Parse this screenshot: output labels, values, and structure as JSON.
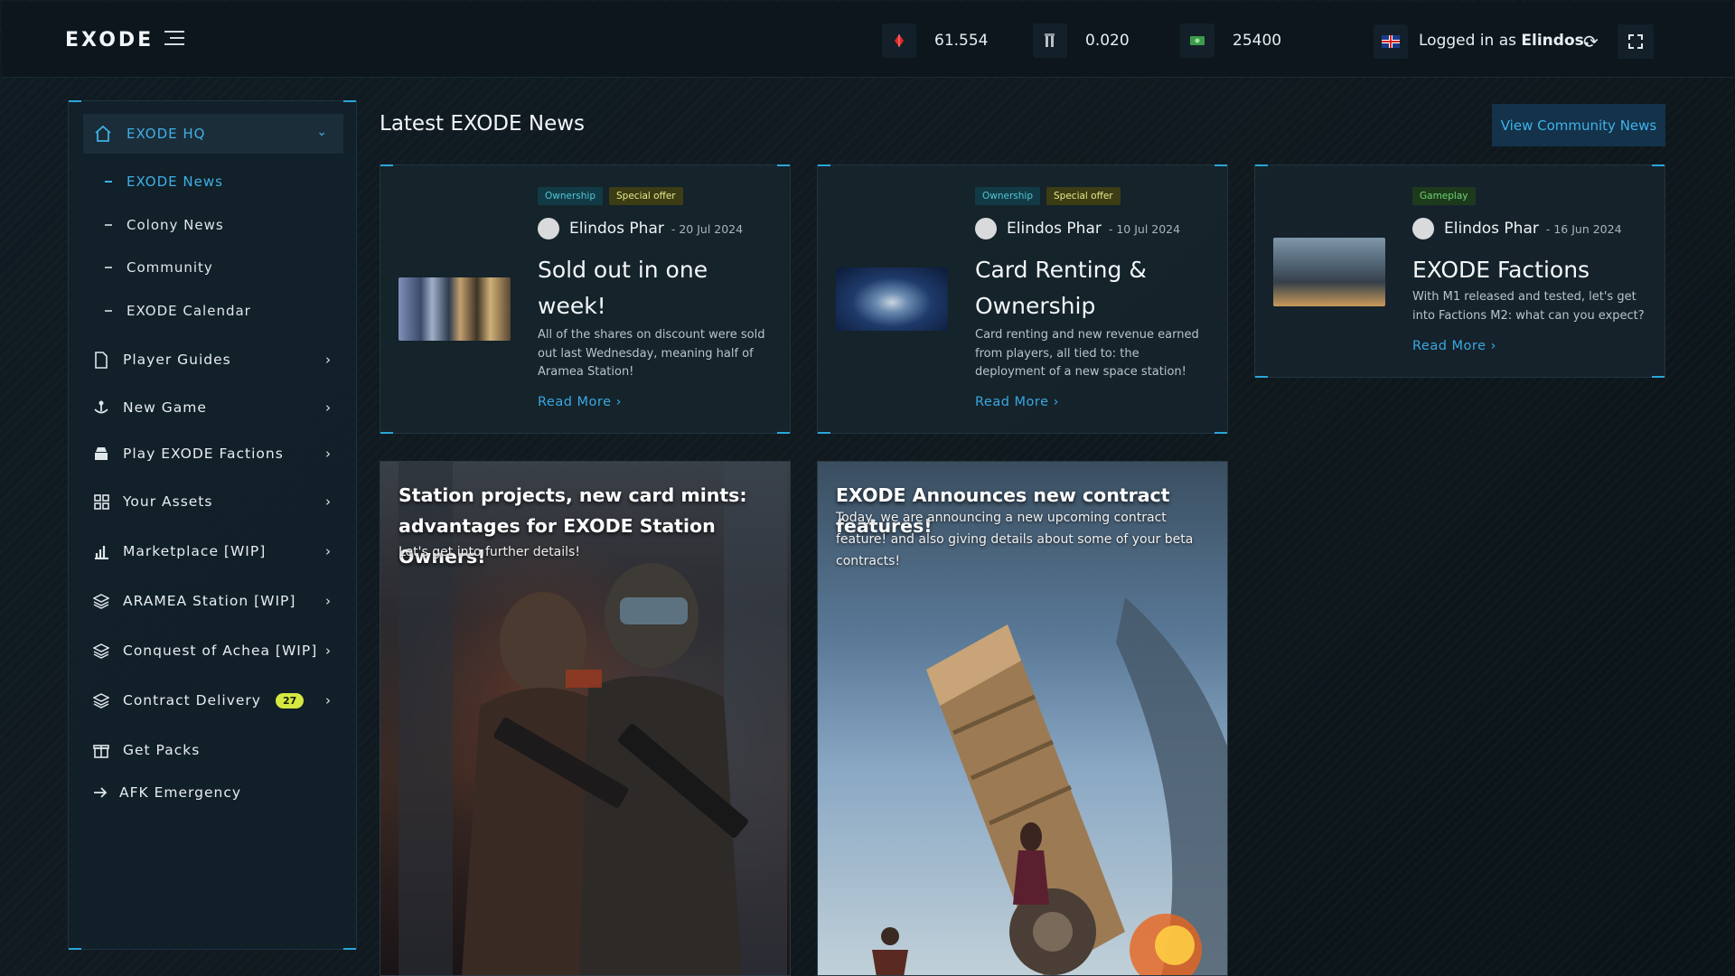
{
  "header": {
    "logo": "EXODE",
    "resources": [
      {
        "icon": "red-crystal-icon",
        "value": "61.554"
      },
      {
        "icon": "tower-token-icon",
        "value": "0.020"
      },
      {
        "icon": "cash-icon",
        "value": "25400"
      }
    ],
    "logged_prefix": "Logged in as",
    "username": "Elindos."
  },
  "sidebar": {
    "active_section": "EXODE HQ",
    "sub_items": [
      "EXODE News",
      "Colony News",
      "Community",
      "EXODE Calendar"
    ],
    "items": [
      {
        "label": "Player Guides",
        "icon": "document-icon"
      },
      {
        "label": "New Game",
        "icon": "anchor-icon"
      },
      {
        "label": "Play EXODE Factions",
        "icon": "factions-icon"
      },
      {
        "label": "Your Assets",
        "icon": "grid-icon"
      },
      {
        "label": "Marketplace [WIP]",
        "icon": "bar-chart-icon"
      },
      {
        "label": "ARAMEA Station [WIP]",
        "icon": "layers-icon"
      },
      {
        "label": "Conquest of Achea [WIP]",
        "icon": "layers-icon"
      },
      {
        "label": "Contract Delivery",
        "icon": "layers-icon",
        "badge": "27"
      },
      {
        "label": "Get Packs",
        "icon": "gift-icon"
      },
      {
        "label": "AFK Emergency",
        "icon": "exit-arrow-icon"
      }
    ]
  },
  "main": {
    "title": "Latest EXODE News",
    "view_button": "View Community News",
    "cards": [
      {
        "tags": [
          "Ownership",
          "Special offer"
        ],
        "author": "Elindos Phar",
        "date": "- 20 Jul 2024",
        "title": "Sold out in one week!",
        "desc": "All of the shares on discount were sold out last Wednesday, meaning half of Aramea Station!",
        "read_more": "Read More ›"
      },
      {
        "tags": [
          "Ownership",
          "Special offer"
        ],
        "author": "Elindos Phar",
        "date": "- 10 Jul 2024",
        "title": "Card Renting & Ownership",
        "desc": "Card renting and new revenue earned from players, all tied to: the deployment of a new space station!",
        "read_more": "Read More ›"
      },
      {
        "tags": [
          "Gameplay"
        ],
        "author": "Elindos Phar",
        "date": "- 16 Jun 2024",
        "title": "EXODE Factions",
        "desc": "With M1 released and tested, let's get into Factions M2: what can you expect?",
        "read_more": "Read More ›"
      }
    ],
    "feature_cards": [
      {
        "title": "Station projects, new card mints: advantages for EXODE Station Owners!",
        "subtitle": "Let's get into further details!"
      },
      {
        "title": "EXODE Announces new contract features!",
        "subtitle": "Today, we are announcing a new upcoming contract feature! and also giving details about some of your beta contracts!"
      }
    ]
  },
  "colors": {
    "accent": "#3fb0e6",
    "badge": "#d6e842",
    "tag_ownership": "#4fc6d2",
    "tag_special": "#e8e88a",
    "tag_gameplay": "#6fd36f"
  }
}
